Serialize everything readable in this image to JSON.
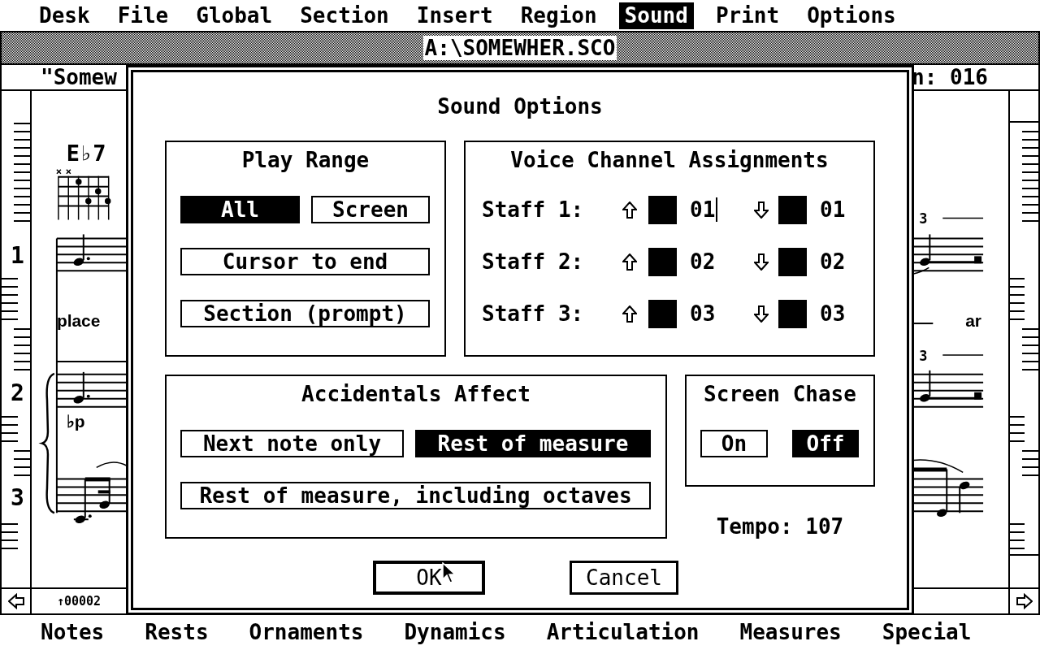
{
  "menu_bar": [
    {
      "label": "Desk",
      "selected": false
    },
    {
      "label": "File",
      "selected": false
    },
    {
      "label": "Global",
      "selected": false
    },
    {
      "label": "Section",
      "selected": false
    },
    {
      "label": "Insert",
      "selected": false
    },
    {
      "label": "Region",
      "selected": false
    },
    {
      "label": "Sound",
      "selected": true
    },
    {
      "label": "Print",
      "selected": false
    },
    {
      "label": "Options",
      "selected": false
    }
  ],
  "window": {
    "title": "A:\\SOMEWHER.SCO",
    "header_left": "\"Somew",
    "header_right": "n: 016"
  },
  "ruler": {
    "staff_numbers": [
      "1",
      "2",
      "3"
    ]
  },
  "score": {
    "chord": "E♭7",
    "lyrics": [
      "place",
      "ar"
    ],
    "triplets": [
      "3",
      "3"
    ],
    "dynamic": "♭p"
  },
  "status": {
    "position": "↑00002"
  },
  "dialog": {
    "title": "Sound Options",
    "play_range": {
      "title": "Play Range",
      "options": [
        {
          "label": "All",
          "selected": true
        },
        {
          "label": "Screen",
          "selected": false
        },
        {
          "label": "Cursor to end",
          "selected": false
        },
        {
          "label": "Section (prompt)",
          "selected": false
        }
      ]
    },
    "voice_channels": {
      "title": "Voice Channel Assignments",
      "rows": [
        {
          "label": "Staff 1:",
          "up": {
            "value": "01",
            "focused": true
          },
          "down": {
            "value": "01",
            "focused": false
          }
        },
        {
          "label": "Staff 2:",
          "up": {
            "value": "02",
            "focused": false
          },
          "down": {
            "value": "02",
            "focused": false
          }
        },
        {
          "label": "Staff 3:",
          "up": {
            "value": "03",
            "focused": false
          },
          "down": {
            "value": "03",
            "focused": false
          }
        }
      ]
    },
    "accidentals": {
      "title": "Accidentals Affect",
      "options": [
        {
          "label": "Next note only",
          "selected": false
        },
        {
          "label": "Rest of measure",
          "selected": true
        },
        {
          "label": "Rest of measure, including octaves",
          "selected": false
        }
      ]
    },
    "screen_chase": {
      "title": "Screen Chase",
      "options": [
        {
          "label": "On",
          "selected": false
        },
        {
          "label": "Off",
          "selected": true
        }
      ]
    },
    "tempo": "Tempo: 107",
    "buttons": [
      {
        "label": "OK",
        "default": true
      },
      {
        "label": "Cancel",
        "default": false
      }
    ]
  },
  "bottom_menu": [
    "Notes",
    "Rests",
    "Ornaments",
    "Dynamics",
    "Articulation",
    "Measures",
    "Special"
  ]
}
